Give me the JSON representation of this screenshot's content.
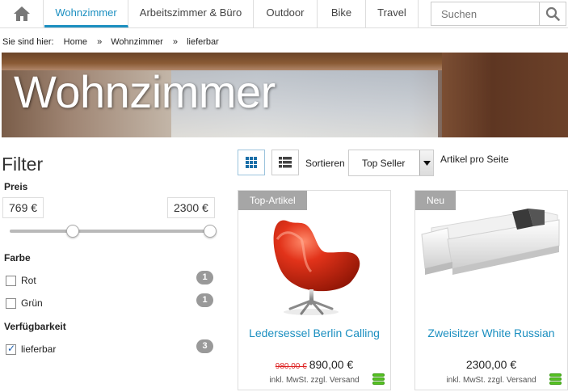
{
  "nav": {
    "tabs": [
      {
        "label": "Wohnzimmer",
        "active": true
      },
      {
        "label": "Arbeitszimmer & Büro"
      },
      {
        "label": "Outdoor"
      },
      {
        "label": "Bike"
      },
      {
        "label": "Travel"
      }
    ],
    "search_placeholder": "Suchen",
    "icons": {
      "home": "home-icon",
      "search": "search-icon"
    },
    "accent_color": "#1b8fc0"
  },
  "breadcrumb": {
    "prefix": "Sie sind hier:",
    "items": [
      "Home",
      "Wohnzimmer",
      "lieferbar"
    ],
    "separator": "»"
  },
  "hero": {
    "title": "Wohnzimmer"
  },
  "filter": {
    "title": "Filter",
    "price": {
      "label": "Preis",
      "min": "769 €",
      "max": "2300 €"
    },
    "color": {
      "label": "Farbe",
      "options": [
        {
          "label": "Rot",
          "count": "1",
          "checked": false
        },
        {
          "label": "Grün",
          "count": "1",
          "checked": false
        }
      ]
    },
    "availability": {
      "label": "Verfügbarkeit",
      "options": [
        {
          "label": "lieferbar",
          "count": "3",
          "checked": true
        }
      ]
    }
  },
  "toolbar": {
    "view_icons": [
      "grid-view-icon",
      "list-view-icon"
    ],
    "sort_label": "Sortieren",
    "sort_value": "Top Seller",
    "per_page_label": "Artikel pro Seite"
  },
  "products": [
    {
      "badge": "Top-Artikel",
      "name": "Ledersessel Berlin Calling",
      "old_price": "980,00 €",
      "price": "890,00 €",
      "vat": "inkl. MwSt. zzgl. Versand"
    },
    {
      "badge": "Neu",
      "name": "Zweisitzer White Russian",
      "price": "2300,00 €",
      "vat": "inkl. MwSt. zzgl. Versand"
    }
  ]
}
